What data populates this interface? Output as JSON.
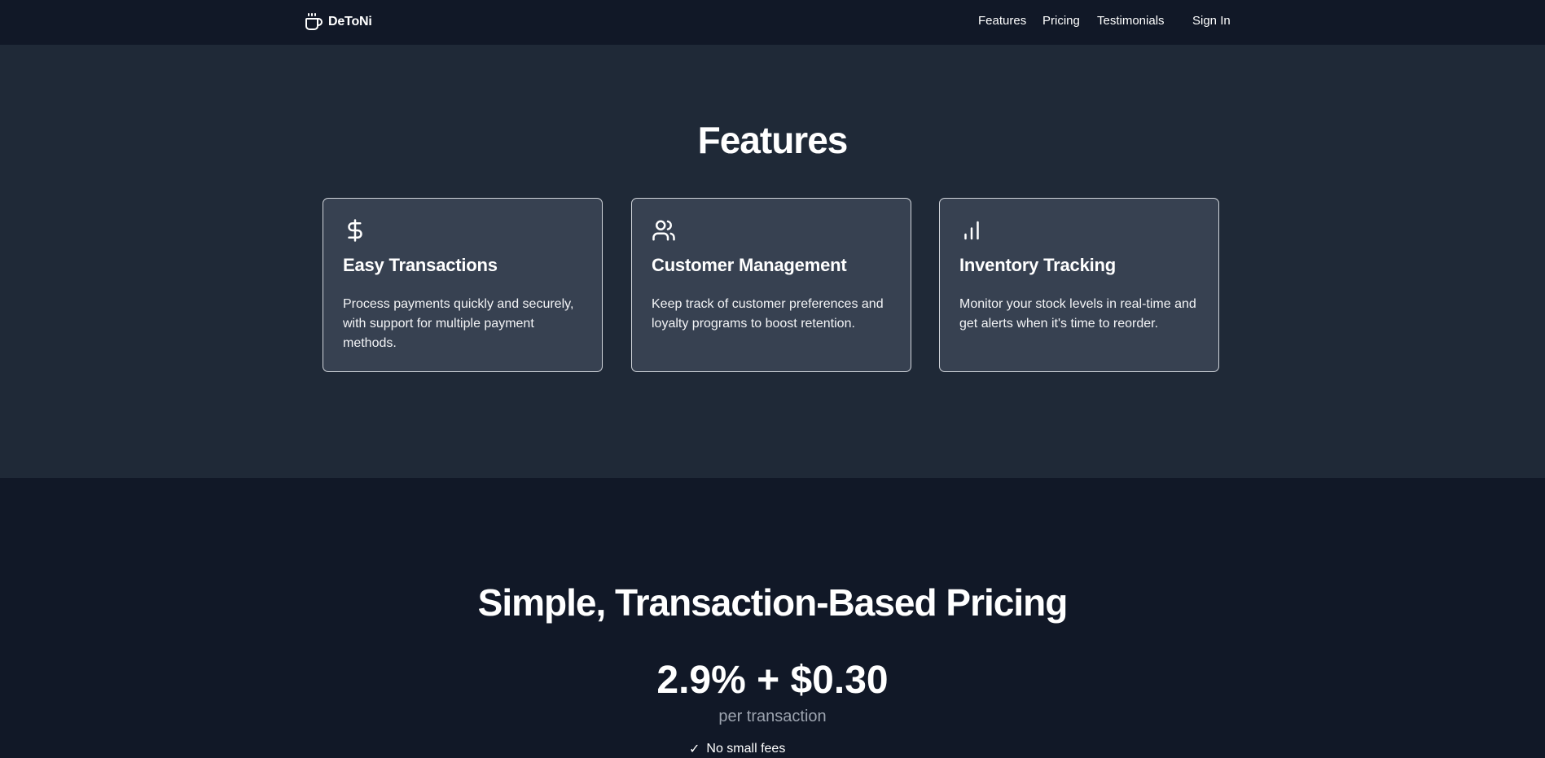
{
  "header": {
    "brand": "DeToNi",
    "nav": [
      "Features",
      "Pricing",
      "Testimonials"
    ],
    "sign_in": "Sign In"
  },
  "features": {
    "title": "Features",
    "cards": [
      {
        "icon": "dollar-sign-icon",
        "title": "Easy Transactions",
        "text": "Process payments quickly and securely, with support for multiple payment methods."
      },
      {
        "icon": "users-icon",
        "title": "Customer Management",
        "text": "Keep track of customer preferences and loyalty programs to boost retention."
      },
      {
        "icon": "bar-chart-icon",
        "title": "Inventory Tracking",
        "text": "Monitor your stock levels in real-time and get alerts when it's time to reorder."
      }
    ]
  },
  "pricing": {
    "title": "Simple, Transaction-Based Pricing",
    "price": "2.9% + $0.30",
    "unit": "per transaction",
    "partial_item": "No small fees"
  },
  "colors": {
    "header_bg": "#111827",
    "features_bg": "#1f2937",
    "card_bg": "#374151",
    "card_border": "#d1d5db",
    "muted_text": "#9ca3af"
  }
}
